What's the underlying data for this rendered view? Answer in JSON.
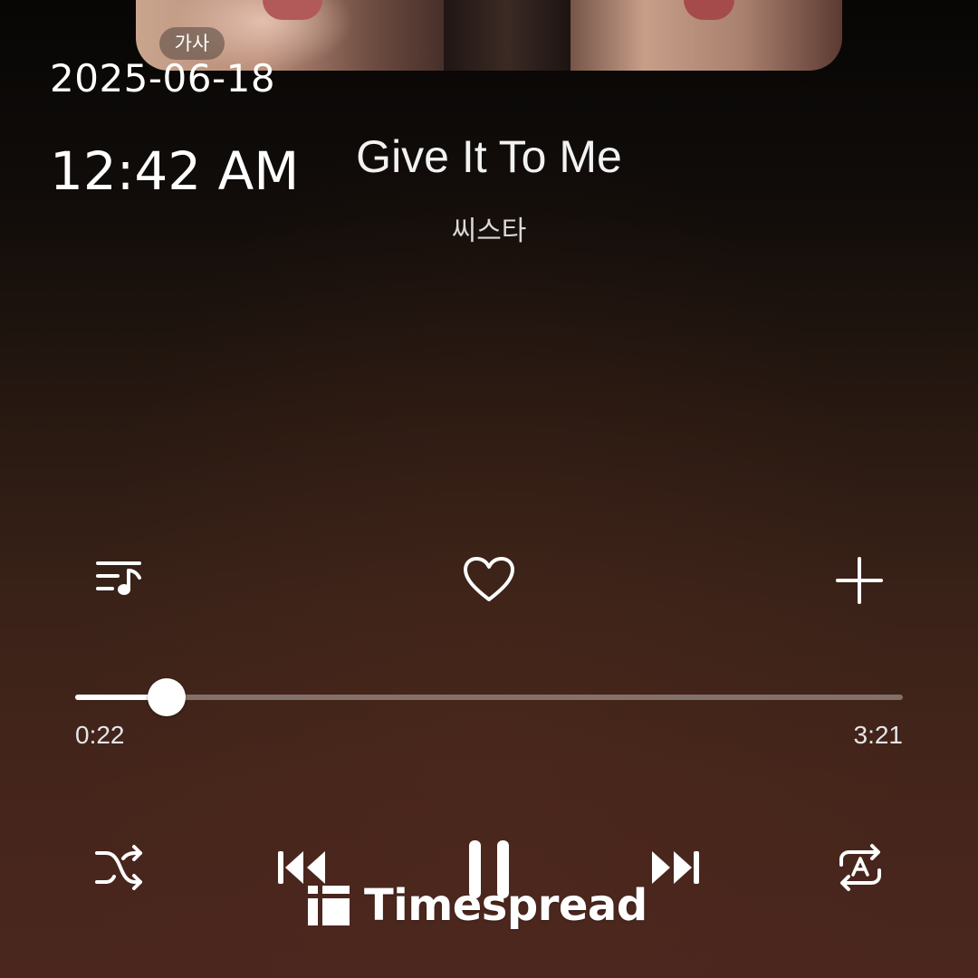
{
  "status": {
    "date": "2025-06-18",
    "time": "12:42 AM"
  },
  "album": {
    "lyrics_badge": "가사"
  },
  "track": {
    "title": "Give It To Me",
    "artist": "씨스타"
  },
  "actions": {
    "playlist_icon": "playlist-music-icon",
    "like_icon": "heart-outline-icon",
    "add_icon": "plus-icon"
  },
  "progress": {
    "elapsed": "0:22",
    "total": "3:21",
    "fraction": 0.11
  },
  "controls": {
    "shuffle_icon": "shuffle-icon",
    "previous_icon": "skip-previous-icon",
    "play_state_icon": "pause-icon",
    "next_icon": "skip-next-icon",
    "repeat_icon": "repeat-icon"
  },
  "watermark": {
    "text": "Timespread"
  },
  "colors": {
    "accent": "#ffffff",
    "background_top": "#070605",
    "background_bottom": "#4a261f"
  }
}
